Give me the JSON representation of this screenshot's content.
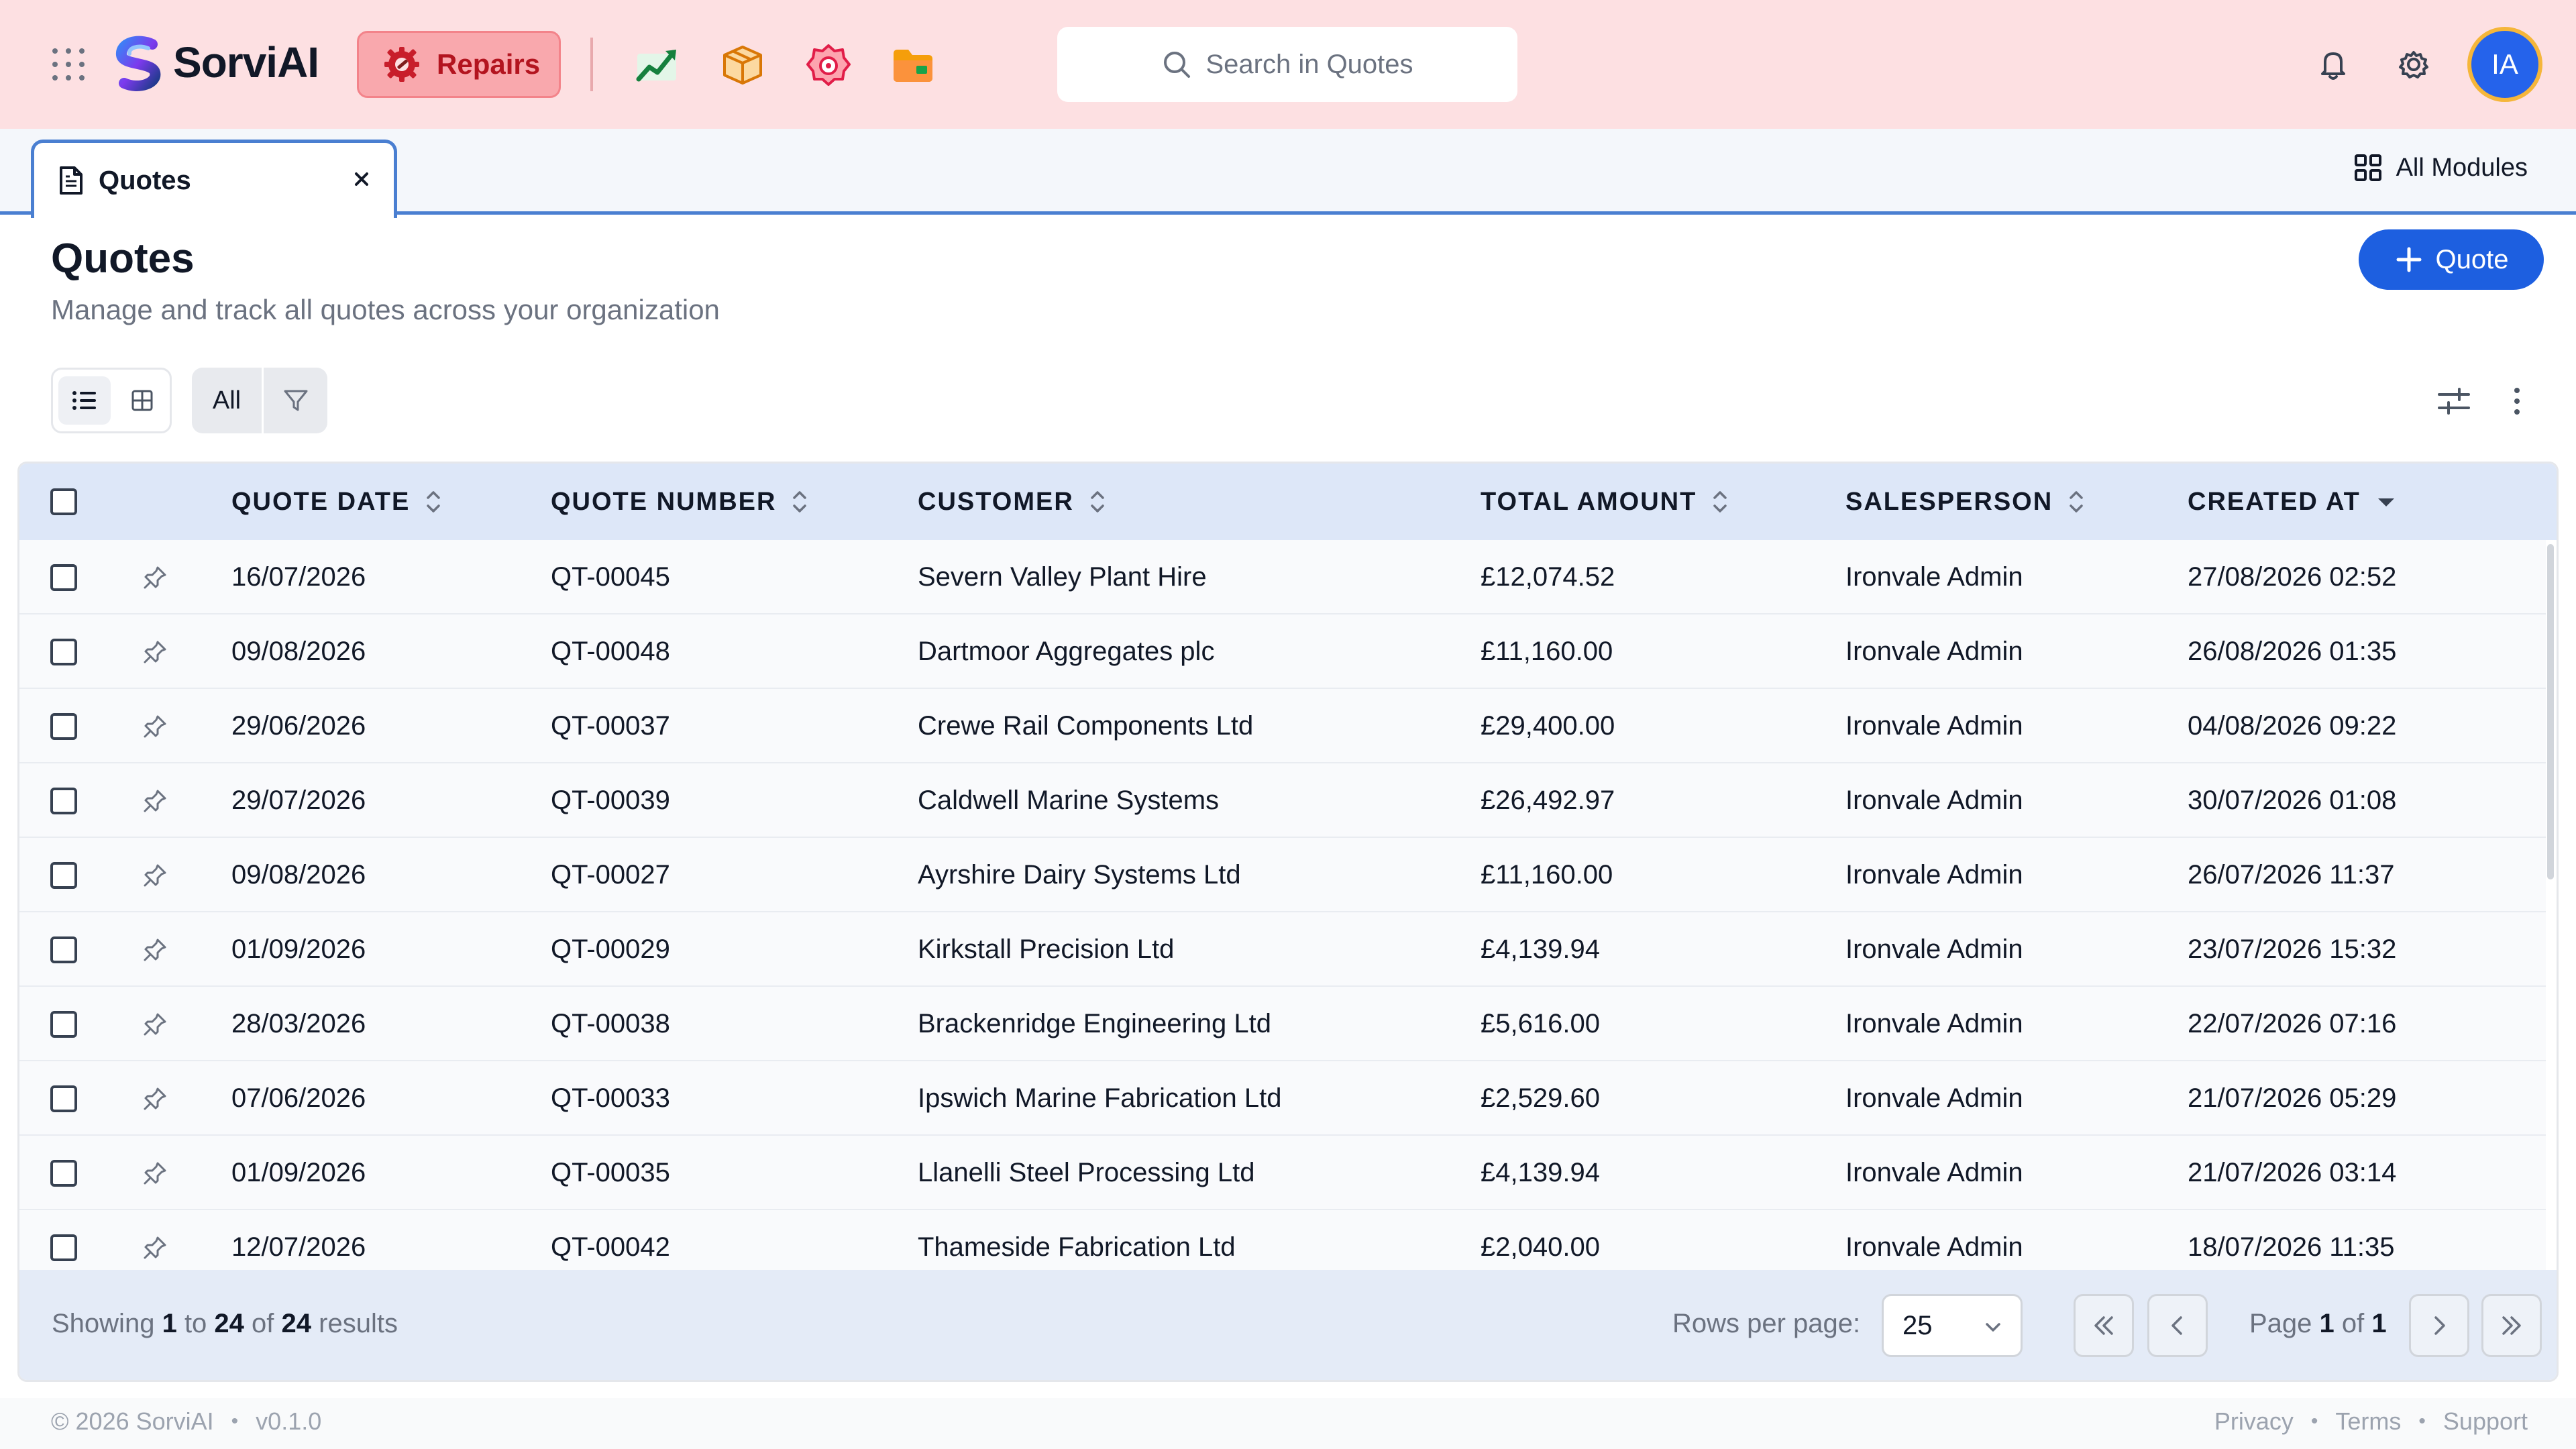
{
  "app": {
    "name": "SorviAI"
  },
  "header": {
    "active_module": "Repairs",
    "module_icons": [
      "chart-up-icon",
      "box-icon",
      "target-badge-icon",
      "folder-icon"
    ],
    "search_placeholder": "Search in Quotes",
    "avatar_initials": "IA"
  },
  "tabs": {
    "active_label": "Quotes",
    "all_modules_label": "All Modules"
  },
  "page": {
    "title": "Quotes",
    "subtitle": "Manage and track all quotes across your organization",
    "add_button_label": "Quote"
  },
  "toolbar": {
    "filter_all_label": "All"
  },
  "table": {
    "columns": [
      "QUOTE DATE",
      "QUOTE NUMBER",
      "CUSTOMER",
      "TOTAL AMOUNT",
      "SALESPERSON",
      "CREATED AT"
    ],
    "sorted_column": "CREATED AT",
    "sort_direction": "desc",
    "rows": [
      {
        "quote_date": "16/07/2026",
        "quote_number": "QT-00045",
        "customer": "Severn Valley Plant Hire",
        "total_amount": "£12,074.52",
        "salesperson": "Ironvale Admin",
        "created_at": "27/08/2026 02:52"
      },
      {
        "quote_date": "09/08/2026",
        "quote_number": "QT-00048",
        "customer": "Dartmoor Aggregates plc",
        "total_amount": "£11,160.00",
        "salesperson": "Ironvale Admin",
        "created_at": "26/08/2026 01:35"
      },
      {
        "quote_date": "29/06/2026",
        "quote_number": "QT-00037",
        "customer": "Crewe Rail Components Ltd",
        "total_amount": "£29,400.00",
        "salesperson": "Ironvale Admin",
        "created_at": "04/08/2026 09:22"
      },
      {
        "quote_date": "29/07/2026",
        "quote_number": "QT-00039",
        "customer": "Caldwell Marine Systems",
        "total_amount": "£26,492.97",
        "salesperson": "Ironvale Admin",
        "created_at": "30/07/2026 01:08"
      },
      {
        "quote_date": "09/08/2026",
        "quote_number": "QT-00027",
        "customer": "Ayrshire Dairy Systems Ltd",
        "total_amount": "£11,160.00",
        "salesperson": "Ironvale Admin",
        "created_at": "26/07/2026 11:37"
      },
      {
        "quote_date": "01/09/2026",
        "quote_number": "QT-00029",
        "customer": "Kirkstall Precision Ltd",
        "total_amount": "£4,139.94",
        "salesperson": "Ironvale Admin",
        "created_at": "23/07/2026 15:32"
      },
      {
        "quote_date": "28/03/2026",
        "quote_number": "QT-00038",
        "customer": "Brackenridge Engineering Ltd",
        "total_amount": "£5,616.00",
        "salesperson": "Ironvale Admin",
        "created_at": "22/07/2026 07:16"
      },
      {
        "quote_date": "07/06/2026",
        "quote_number": "QT-00033",
        "customer": "Ipswich Marine Fabrication Ltd",
        "total_amount": "£2,529.60",
        "salesperson": "Ironvale Admin",
        "created_at": "21/07/2026 05:29"
      },
      {
        "quote_date": "01/09/2026",
        "quote_number": "QT-00035",
        "customer": "Llanelli Steel Processing Ltd",
        "total_amount": "£4,139.94",
        "salesperson": "Ironvale Admin",
        "created_at": "21/07/2026 03:14"
      },
      {
        "quote_date": "12/07/2026",
        "quote_number": "QT-00042",
        "customer": "Thameside Fabrication Ltd",
        "total_amount": "£2,040.00",
        "salesperson": "Ironvale Admin",
        "created_at": "18/07/2026 11:35"
      }
    ]
  },
  "pagination": {
    "showing_prefix": "Showing",
    "from": "1",
    "to_word": "to",
    "to": "24",
    "of_word": "of",
    "total": "24",
    "results_word": "results",
    "rows_per_page_label": "Rows per page:",
    "rows_per_page_value": "25",
    "page_word": "Page",
    "current_page": "1",
    "page_of_word": "of",
    "total_pages": "1"
  },
  "footer": {
    "copyright": "© 2026 SorviAI",
    "version": "v0.1.0",
    "links": [
      "Privacy",
      "Terms",
      "Support"
    ]
  },
  "colors": {
    "topbar_bg": "#fde0e2",
    "accent_blue": "#1d5fe0",
    "repairs_red": "#b3141f",
    "table_header_bg": "#dde7f8"
  }
}
